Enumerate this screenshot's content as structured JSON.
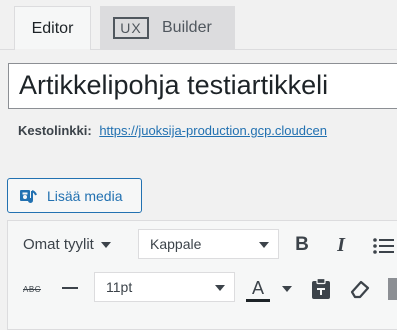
{
  "tabs": {
    "editor_label": "Editor",
    "builder_badge": "UX",
    "builder_label": "Builder"
  },
  "post": {
    "title": "Artikkelipohja testiartikkeli"
  },
  "permalink": {
    "label": "Kestolinkki:",
    "url": "https://juoksija-production.gcp.cloudcen"
  },
  "media": {
    "button_label": "Lisää media"
  },
  "toolbar": {
    "styles_label": "Omat tyylit",
    "format_value": "Kappale",
    "font_size_value": "11pt",
    "bold_label": "B",
    "italic_label": "I",
    "strikethrough_label": "ABC",
    "text_color_label": "A"
  },
  "colors": {
    "accent": "#2271b1",
    "text_color_swatch": "#1d2327"
  }
}
